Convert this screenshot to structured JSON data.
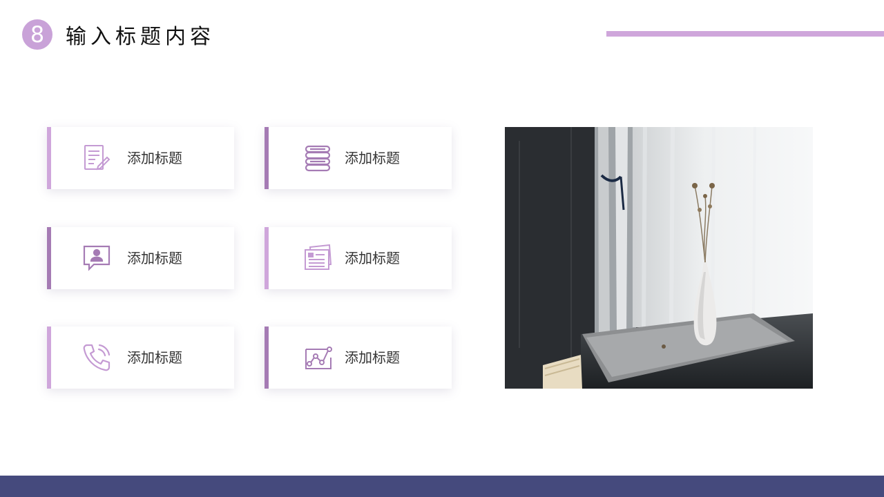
{
  "header": {
    "badge_number": "8",
    "title": "输入标题内容"
  },
  "colors": {
    "accent_light": "#cfa6db",
    "accent_dark": "#a57bb4",
    "footer": "#454a7d"
  },
  "cards": [
    {
      "label": "添加标题",
      "icon": "document-edit-icon"
    },
    {
      "label": "添加标题",
      "icon": "stacked-layers-icon"
    },
    {
      "label": "添加标题",
      "icon": "chat-user-icon"
    },
    {
      "label": "添加标题",
      "icon": "news-documents-icon"
    },
    {
      "label": "添加标题",
      "icon": "phone-call-icon"
    },
    {
      "label": "添加标题",
      "icon": "line-chart-icon"
    }
  ],
  "photo": {
    "subject": "vase-window-photo"
  }
}
